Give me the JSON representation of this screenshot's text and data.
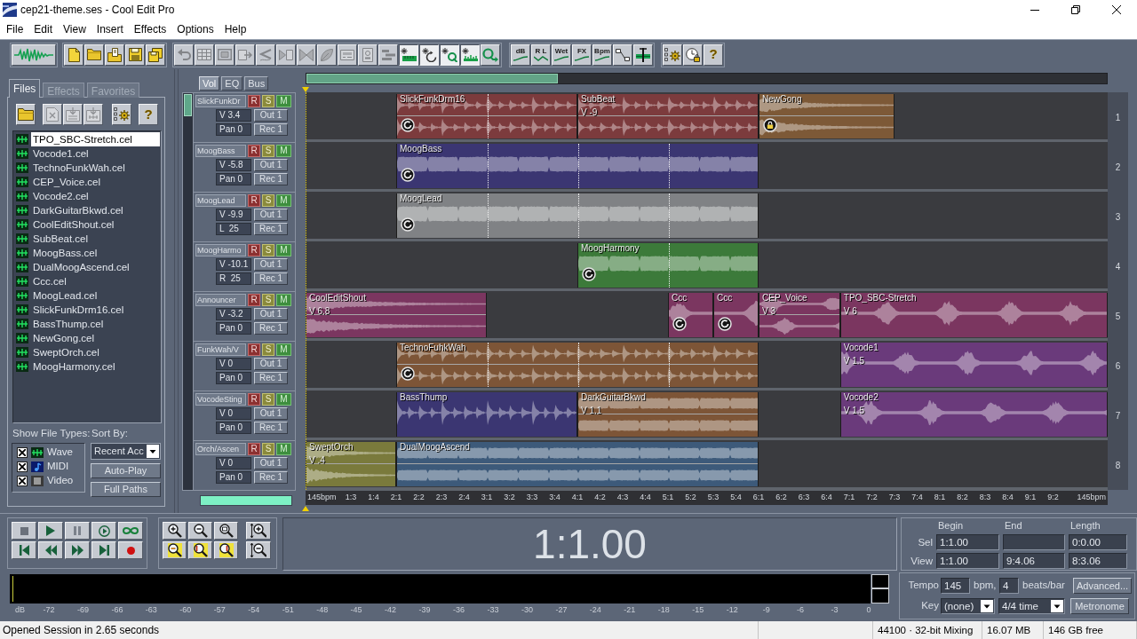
{
  "window": {
    "title": "cep21-theme.ses - Cool Edit Pro"
  },
  "menu": [
    "File",
    "Edit",
    "View",
    "Insert",
    "Effects",
    "Options",
    "Help"
  ],
  "toolbar": [
    {
      "buttons": [
        {
          "kind": "waveform-view"
        }
      ]
    },
    {
      "buttons": [
        {
          "kind": "new"
        },
        {
          "kind": "open"
        },
        {
          "kind": "open-append"
        },
        {
          "kind": "save"
        },
        {
          "kind": "save-all"
        }
      ]
    },
    {
      "buttons": [
        {
          "kind": "undo",
          "disabled": true,
          "on": false
        },
        {
          "kind": "mixdown",
          "disabled": true,
          "on": false
        },
        {
          "kind": "frame",
          "disabled": true,
          "on": false
        },
        {
          "kind": "crop",
          "disabled": true,
          "on": false
        },
        {
          "kind": "squiggle",
          "disabled": true,
          "on": false
        },
        {
          "kind": "arrow-block",
          "disabled": true,
          "on": false
        },
        {
          "kind": "bowtie",
          "disabled": true,
          "on": false
        },
        {
          "kind": "leaf",
          "disabled": true,
          "on": false
        },
        {
          "kind": "panel",
          "disabled": true,
          "on": false
        },
        {
          "kind": "device",
          "disabled": true,
          "on": false
        },
        {
          "kind": "steps",
          "disabled": true,
          "on": false
        },
        {
          "kind": "snap-ruler",
          "disabled": false,
          "on": true
        },
        {
          "kind": "snap-circle",
          "disabled": false,
          "on": true
        },
        {
          "kind": "snap-loop",
          "disabled": false,
          "on": true
        },
        {
          "kind": "snap-bars",
          "disabled": false,
          "on": true
        },
        {
          "kind": "loop-arrow",
          "disabled": false,
          "on": false
        }
      ]
    },
    {
      "buttons": [
        {
          "kind": "curve-label",
          "label": "dB"
        },
        {
          "kind": "zigzag-label",
          "label": "R L"
        },
        {
          "kind": "curve-label",
          "label": "Wet"
        },
        {
          "kind": "curve-label",
          "label": "FX"
        },
        {
          "kind": "curve-label",
          "label": "Bpm"
        },
        {
          "kind": "nodes"
        },
        {
          "kind": "wave-marker"
        }
      ]
    },
    {
      "buttons": [
        {
          "kind": "settings"
        },
        {
          "kind": "clock-lock"
        },
        {
          "kind": "help",
          "label": "?"
        }
      ]
    }
  ],
  "file_panel": {
    "tabs": [
      {
        "label": "Files",
        "selected": true
      },
      {
        "label": "Effects",
        "selected": false
      },
      {
        "label": "Favorites",
        "selected": false
      }
    ],
    "toolbar": [
      {
        "kind": "open",
        "disabled": false
      },
      {
        "kind": "close",
        "disabled": true
      },
      {
        "kind": "insert",
        "disabled": true
      },
      {
        "kind": "insert-multi",
        "disabled": true
      },
      {
        "kind": "options",
        "disabled": false
      },
      {
        "kind": "help",
        "label": "?",
        "disabled": false
      }
    ],
    "files": [
      {
        "name": "TPO_SBC-Stretch.cel",
        "selected": true
      },
      {
        "name": "Vocode1.cel",
        "selected": false
      },
      {
        "name": "TechnoFunkWah.cel",
        "selected": false
      },
      {
        "name": "CEP_Voice.cel",
        "selected": false
      },
      {
        "name": "Vocode2.cel",
        "selected": false
      },
      {
        "name": "DarkGuitarBkwd.cel",
        "selected": false
      },
      {
        "name": "CoolEditShout.cel",
        "selected": false
      },
      {
        "name": "SubBeat.cel",
        "selected": false
      },
      {
        "name": "MoogBass.cel",
        "selected": false
      },
      {
        "name": "DualMoogAscend.cel",
        "selected": false
      },
      {
        "name": "Ccc.cel",
        "selected": false
      },
      {
        "name": "MoogLead.cel",
        "selected": false
      },
      {
        "name": "SlickFunkDrm16.cel",
        "selected": false
      },
      {
        "name": "BassThump.cel",
        "selected": false
      },
      {
        "name": "NewGong.cel",
        "selected": false
      },
      {
        "name": "SweptOrch.cel",
        "selected": false
      },
      {
        "name": "MoogHarmony.cel",
        "selected": false
      }
    ],
    "show_file_types": {
      "label": "Show File Types:",
      "types": [
        {
          "kind": "wave",
          "label": "Wave",
          "checked": true
        },
        {
          "kind": "midi",
          "label": "MIDI",
          "checked": true
        },
        {
          "kind": "video",
          "label": "Video",
          "checked": true
        }
      ]
    },
    "sort_by": {
      "label": "Sort By:",
      "value": "Recent Acc"
    },
    "buttons": [
      "Auto-Play",
      "Full Paths"
    ]
  },
  "track_controls": {
    "tabs": [
      {
        "label": "Vol",
        "selected": true
      },
      {
        "label": "EQ",
        "selected": false
      },
      {
        "label": "Bus",
        "selected": false
      }
    ],
    "tracks": [
      {
        "name": "SlickFunkDr",
        "record_arm": "R",
        "solo": "S",
        "mute": "M",
        "volume": "V 3.4",
        "output": "Out 1",
        "pan": "Pan 0",
        "record_device": "Rec 1"
      },
      {
        "name": "MoogBass",
        "record_arm": "R",
        "solo": "S",
        "mute": "M",
        "volume": "V -5.8",
        "output": "Out 1",
        "pan": "Pan 0",
        "record_device": "Rec 1"
      },
      {
        "name": "MoogLead",
        "record_arm": "R",
        "solo": "S",
        "mute": "M",
        "volume": "V -9.9",
        "output": "Out 1",
        "pan": "L  25",
        "record_device": "Rec 1"
      },
      {
        "name": "MoogHarmo",
        "record_arm": "R",
        "solo": "S",
        "mute": "M",
        "volume": "V -10.1",
        "output": "Out 1",
        "pan": "R  25",
        "record_device": "Rec 1"
      },
      {
        "name": "Announcer",
        "record_arm": "R",
        "solo": "S",
        "mute": "M",
        "volume": "V -3.2",
        "output": "Out 1",
        "pan": "Pan 0",
        "record_device": "Rec 1"
      },
      {
        "name": "FunkWah/V",
        "record_arm": "R",
        "solo": "S",
        "mute": "M",
        "volume": "V 0",
        "output": "Out 1",
        "pan": "Pan 0",
        "record_device": "Rec 1"
      },
      {
        "name": "VocodeSting",
        "record_arm": "R",
        "solo": "S",
        "mute": "M",
        "volume": "V 0",
        "output": "Out 1",
        "pan": "Pan 0",
        "record_device": "Rec 1"
      },
      {
        "name": "Orch/Ascen",
        "record_arm": "R",
        "solo": "S",
        "mute": "M",
        "volume": "V 0",
        "output": "Out 1",
        "pan": "Pan 0",
        "record_device": "Rec 1"
      }
    ]
  },
  "timeline": {
    "lanes": [
      {
        "number": "1",
        "clips": [
          {
            "name": "SlickFunkDrm16",
            "color": "#7c3b3d",
            "kind": "percussive",
            "stereo": true,
            "looped": true,
            "locked": false
          },
          {
            "name": "SubBeat",
            "volume": "V -9",
            "color": "#7c3b3d",
            "kind": "percussive",
            "stereo": true,
            "looped": false,
            "locked": false
          },
          {
            "name": "NewGong",
            "color": "#7d5937",
            "kind": "decaying",
            "stereo": true,
            "looped": false,
            "locked": true
          }
        ]
      },
      {
        "number": "2",
        "clips": [
          {
            "name": "MoogBass",
            "color": "#3b3672",
            "kind": "sustained",
            "stereo": false,
            "looped": true,
            "locked": false
          }
        ]
      },
      {
        "number": "3",
        "clips": [
          {
            "name": "MoogLead",
            "color": "#808285",
            "kind": "sustained",
            "stereo": false,
            "looped": true,
            "locked": false
          }
        ]
      },
      {
        "number": "4",
        "clips": [
          {
            "name": "MoogHarmony",
            "color": "#3c7a3a",
            "kind": "sustained",
            "stereo": false,
            "looped": true,
            "locked": false
          }
        ]
      },
      {
        "number": "5",
        "clips": [
          {
            "name": "CoolEditShout",
            "volume": "V 6.8",
            "color": "#7b3660",
            "kind": "decaying",
            "stereo": true,
            "looped": false,
            "locked": false
          },
          {
            "name": "Ccc",
            "color": "#7b3660",
            "kind": "vocal",
            "stereo": false,
            "looped": true,
            "locked": false
          },
          {
            "name": "Ccc",
            "color": "#7b3660",
            "kind": "vocal",
            "stereo": false,
            "looped": true,
            "locked": false
          },
          {
            "name": "CEP_Voice",
            "volume": "V 3",
            "color": "#7b3660",
            "kind": "vocal",
            "stereo": true,
            "looped": false,
            "locked": false
          },
          {
            "name": "TPO_SBC-Stretch",
            "volume": "V 6",
            "color": "#7b3660",
            "kind": "vocal",
            "stereo": false,
            "looped": false,
            "locked": false
          }
        ]
      },
      {
        "number": "6",
        "clips": [
          {
            "name": "TechnoFuhkWah",
            "color": "#7d5537",
            "kind": "percussive",
            "stereo": true,
            "looped": true,
            "locked": false
          },
          {
            "name": "Vocode1",
            "volume": "V 1.5",
            "color": "#6a3a7b",
            "kind": "vocal",
            "stereo": false,
            "looped": false,
            "locked": false
          }
        ]
      },
      {
        "number": "7",
        "clips": [
          {
            "name": "BassThump",
            "color": "#3b3672",
            "kind": "percussive",
            "stereo": false,
            "looped": false,
            "locked": false
          },
          {
            "name": "DarkGuitarBkwd",
            "volume": "V 1.1",
            "color": "#7d5537",
            "kind": "sustained",
            "stereo": true,
            "looped": false,
            "locked": false
          },
          {
            "name": "Vocode2",
            "volume": "V 1.5",
            "color": "#6a3a7b",
            "kind": "vocal",
            "stereo": false,
            "looped": false,
            "locked": false
          }
        ]
      },
      {
        "number": "8",
        "clips": [
          {
            "name": "SweptOrch",
            "volume": "V .4",
            "color": "#7a7a3c",
            "kind": "decaying",
            "stereo": true,
            "looped": false,
            "locked": false
          },
          {
            "name": "DualMoogAscend",
            "color": "#3d5a7a",
            "kind": "sustained",
            "stereo": true,
            "looped": false,
            "locked": false
          }
        ]
      }
    ],
    "ruler": {
      "start_label": "145bpm",
      "ticks": [
        "1:3",
        "1:4",
        "2:1",
        "2:2",
        "2:3",
        "2:4",
        "3:1",
        "3:2",
        "3:3",
        "3:4",
        "4:1",
        "4:2",
        "4:3",
        "4:4",
        "5:1",
        "5:2",
        "5:3",
        "5:4",
        "6:1",
        "6:2",
        "6:3",
        "6:4",
        "7:1",
        "7:2",
        "7:3",
        "7:4",
        "8:1",
        "8:2",
        "8:3",
        "8:4",
        "9:1",
        "9:2"
      ],
      "end_label": "145bpm"
    }
  },
  "transport": [
    {
      "kind": "stop"
    },
    {
      "kind": "play"
    },
    {
      "kind": "pause"
    },
    {
      "kind": "play-loop"
    },
    {
      "kind": "loop"
    },
    {
      "kind": "go-start"
    },
    {
      "kind": "rewind"
    },
    {
      "kind": "forward"
    },
    {
      "kind": "go-end"
    },
    {
      "kind": "record"
    }
  ],
  "zoom": [
    {
      "kind": "zoom-in"
    },
    {
      "kind": "zoom-out"
    },
    {
      "kind": "zoom-full"
    },
    {
      "kind": "vzoom-in"
    },
    {
      "kind": "zoom-selection"
    },
    {
      "kind": "zoom-left"
    },
    {
      "kind": "zoom-right"
    },
    {
      "kind": "vzoom-out"
    }
  ],
  "time_display": "1:1.00",
  "selection": {
    "columns": [
      "Begin",
      "End",
      "Length"
    ],
    "rows": [
      {
        "label": "Sel",
        "begin": "1:1.00",
        "length": "0:0.00"
      },
      {
        "label": "View",
        "begin": "1:1.00",
        "end": "9:4.06",
        "length": "8:3.06"
      }
    ]
  },
  "level_meter": {
    "scale": [
      "dB",
      "-72",
      "-69",
      "-66",
      "-63",
      "-60",
      "-57",
      "-54",
      "-51",
      "-48",
      "-45",
      "-42",
      "-39",
      "-36",
      "-33",
      "-30",
      "-27",
      "-24",
      "-21",
      "-18",
      "-15",
      "-12",
      "-9",
      "-6",
      "-3",
      "0"
    ]
  },
  "tempo": {
    "label": "Tempo",
    "value": "145",
    "unit": "bpm,",
    "beats": "4",
    "beats_unit": "beats/bar",
    "key_label": "Key",
    "key": "(none)",
    "time_signature": "4/4 time",
    "buttons": [
      "Advanced...",
      "Metronome"
    ]
  },
  "status_bar": {
    "message": "Opened Session in 2.65 seconds",
    "sections": [
      "44100 · 32-bit Mixing",
      "16.07 MB",
      "146 GB free"
    ]
  }
}
